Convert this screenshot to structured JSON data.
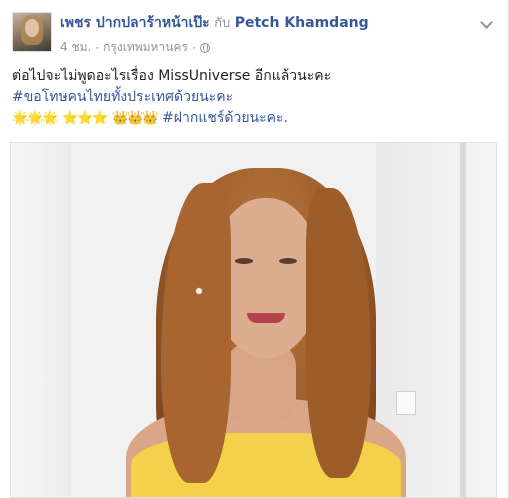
{
  "post": {
    "author": "เพชร ปากปลาร้าหน้าเป๊ะ",
    "with_label": "กับ",
    "tagged": "Petch Khamdang",
    "time": "4 ชม.",
    "location": "กรุงเทพมหานคร",
    "separator": "·",
    "line1": "ต่อไปจะไม่พูดอะไรเรื่อง MissUniverse อีกแล้วนะคะ",
    "line2_hashtag": "#ขอโทษคนไทยทั้งประเทศด้วยนะคะ",
    "line3_sun": "🌟🌟🌟",
    "line3_star": "⭐⭐⭐",
    "line3_crown": "👑👑👑",
    "line3_hashtag": "#ฝากแชร์ด้วยนะคะ."
  },
  "icons": {
    "privacy": "globe-icon",
    "menu": "chevron-down-icon"
  },
  "colors": {
    "link": "#365899",
    "meta": "#90949c",
    "text": "#1d2129",
    "dress": "#f4d14a"
  }
}
